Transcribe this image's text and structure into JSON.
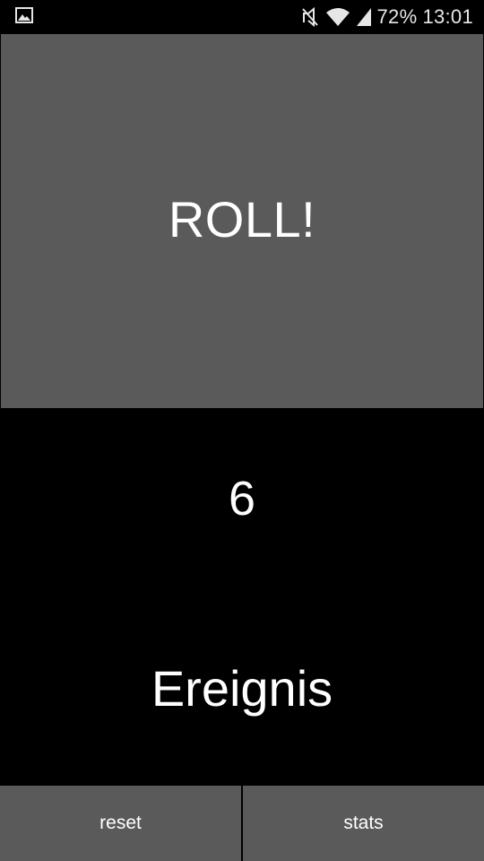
{
  "status_bar": {
    "left_icon": "image-notification-icon",
    "icons": [
      "vibrate-off-icon",
      "wifi-icon",
      "signal-icon"
    ],
    "battery": "72%",
    "time": "13:01"
  },
  "roll_button": {
    "label": "ROLL!"
  },
  "result": {
    "number": "6",
    "event": "Ereignis"
  },
  "bottom_buttons": {
    "reset_label": "reset",
    "stats_label": "stats"
  },
  "colors": {
    "background": "#000000",
    "button": "#5a5a5a",
    "text": "#ffffff"
  }
}
